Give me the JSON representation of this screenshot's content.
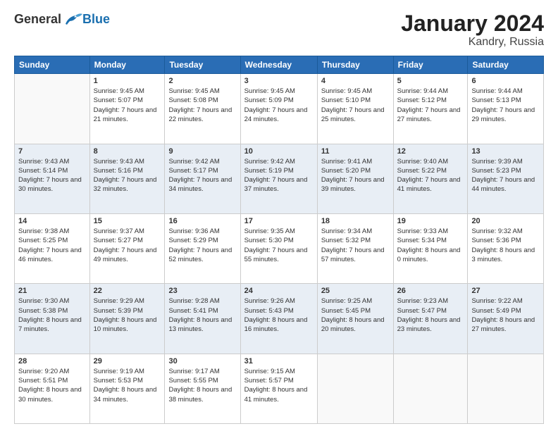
{
  "logo": {
    "general": "General",
    "blue": "Blue"
  },
  "title": "January 2024",
  "location": "Kandry, Russia",
  "days_header": [
    "Sunday",
    "Monday",
    "Tuesday",
    "Wednesday",
    "Thursday",
    "Friday",
    "Saturday"
  ],
  "weeks": [
    [
      {
        "num": "",
        "sunrise": "",
        "sunset": "",
        "daylight": ""
      },
      {
        "num": "1",
        "sunrise": "Sunrise: 9:45 AM",
        "sunset": "Sunset: 5:07 PM",
        "daylight": "Daylight: 7 hours and 21 minutes."
      },
      {
        "num": "2",
        "sunrise": "Sunrise: 9:45 AM",
        "sunset": "Sunset: 5:08 PM",
        "daylight": "Daylight: 7 hours and 22 minutes."
      },
      {
        "num": "3",
        "sunrise": "Sunrise: 9:45 AM",
        "sunset": "Sunset: 5:09 PM",
        "daylight": "Daylight: 7 hours and 24 minutes."
      },
      {
        "num": "4",
        "sunrise": "Sunrise: 9:45 AM",
        "sunset": "Sunset: 5:10 PM",
        "daylight": "Daylight: 7 hours and 25 minutes."
      },
      {
        "num": "5",
        "sunrise": "Sunrise: 9:44 AM",
        "sunset": "Sunset: 5:12 PM",
        "daylight": "Daylight: 7 hours and 27 minutes."
      },
      {
        "num": "6",
        "sunrise": "Sunrise: 9:44 AM",
        "sunset": "Sunset: 5:13 PM",
        "daylight": "Daylight: 7 hours and 29 minutes."
      }
    ],
    [
      {
        "num": "7",
        "sunrise": "Sunrise: 9:43 AM",
        "sunset": "Sunset: 5:14 PM",
        "daylight": "Daylight: 7 hours and 30 minutes."
      },
      {
        "num": "8",
        "sunrise": "Sunrise: 9:43 AM",
        "sunset": "Sunset: 5:16 PM",
        "daylight": "Daylight: 7 hours and 32 minutes."
      },
      {
        "num": "9",
        "sunrise": "Sunrise: 9:42 AM",
        "sunset": "Sunset: 5:17 PM",
        "daylight": "Daylight: 7 hours and 34 minutes."
      },
      {
        "num": "10",
        "sunrise": "Sunrise: 9:42 AM",
        "sunset": "Sunset: 5:19 PM",
        "daylight": "Daylight: 7 hours and 37 minutes."
      },
      {
        "num": "11",
        "sunrise": "Sunrise: 9:41 AM",
        "sunset": "Sunset: 5:20 PM",
        "daylight": "Daylight: 7 hours and 39 minutes."
      },
      {
        "num": "12",
        "sunrise": "Sunrise: 9:40 AM",
        "sunset": "Sunset: 5:22 PM",
        "daylight": "Daylight: 7 hours and 41 minutes."
      },
      {
        "num": "13",
        "sunrise": "Sunrise: 9:39 AM",
        "sunset": "Sunset: 5:23 PM",
        "daylight": "Daylight: 7 hours and 44 minutes."
      }
    ],
    [
      {
        "num": "14",
        "sunrise": "Sunrise: 9:38 AM",
        "sunset": "Sunset: 5:25 PM",
        "daylight": "Daylight: 7 hours and 46 minutes."
      },
      {
        "num": "15",
        "sunrise": "Sunrise: 9:37 AM",
        "sunset": "Sunset: 5:27 PM",
        "daylight": "Daylight: 7 hours and 49 minutes."
      },
      {
        "num": "16",
        "sunrise": "Sunrise: 9:36 AM",
        "sunset": "Sunset: 5:29 PM",
        "daylight": "Daylight: 7 hours and 52 minutes."
      },
      {
        "num": "17",
        "sunrise": "Sunrise: 9:35 AM",
        "sunset": "Sunset: 5:30 PM",
        "daylight": "Daylight: 7 hours and 55 minutes."
      },
      {
        "num": "18",
        "sunrise": "Sunrise: 9:34 AM",
        "sunset": "Sunset: 5:32 PM",
        "daylight": "Daylight: 7 hours and 57 minutes."
      },
      {
        "num": "19",
        "sunrise": "Sunrise: 9:33 AM",
        "sunset": "Sunset: 5:34 PM",
        "daylight": "Daylight: 8 hours and 0 minutes."
      },
      {
        "num": "20",
        "sunrise": "Sunrise: 9:32 AM",
        "sunset": "Sunset: 5:36 PM",
        "daylight": "Daylight: 8 hours and 3 minutes."
      }
    ],
    [
      {
        "num": "21",
        "sunrise": "Sunrise: 9:30 AM",
        "sunset": "Sunset: 5:38 PM",
        "daylight": "Daylight: 8 hours and 7 minutes."
      },
      {
        "num": "22",
        "sunrise": "Sunrise: 9:29 AM",
        "sunset": "Sunset: 5:39 PM",
        "daylight": "Daylight: 8 hours and 10 minutes."
      },
      {
        "num": "23",
        "sunrise": "Sunrise: 9:28 AM",
        "sunset": "Sunset: 5:41 PM",
        "daylight": "Daylight: 8 hours and 13 minutes."
      },
      {
        "num": "24",
        "sunrise": "Sunrise: 9:26 AM",
        "sunset": "Sunset: 5:43 PM",
        "daylight": "Daylight: 8 hours and 16 minutes."
      },
      {
        "num": "25",
        "sunrise": "Sunrise: 9:25 AM",
        "sunset": "Sunset: 5:45 PM",
        "daylight": "Daylight: 8 hours and 20 minutes."
      },
      {
        "num": "26",
        "sunrise": "Sunrise: 9:23 AM",
        "sunset": "Sunset: 5:47 PM",
        "daylight": "Daylight: 8 hours and 23 minutes."
      },
      {
        "num": "27",
        "sunrise": "Sunrise: 9:22 AM",
        "sunset": "Sunset: 5:49 PM",
        "daylight": "Daylight: 8 hours and 27 minutes."
      }
    ],
    [
      {
        "num": "28",
        "sunrise": "Sunrise: 9:20 AM",
        "sunset": "Sunset: 5:51 PM",
        "daylight": "Daylight: 8 hours and 30 minutes."
      },
      {
        "num": "29",
        "sunrise": "Sunrise: 9:19 AM",
        "sunset": "Sunset: 5:53 PM",
        "daylight": "Daylight: 8 hours and 34 minutes."
      },
      {
        "num": "30",
        "sunrise": "Sunrise: 9:17 AM",
        "sunset": "Sunset: 5:55 PM",
        "daylight": "Daylight: 8 hours and 38 minutes."
      },
      {
        "num": "31",
        "sunrise": "Sunrise: 9:15 AM",
        "sunset": "Sunset: 5:57 PM",
        "daylight": "Daylight: 8 hours and 41 minutes."
      },
      {
        "num": "",
        "sunrise": "",
        "sunset": "",
        "daylight": ""
      },
      {
        "num": "",
        "sunrise": "",
        "sunset": "",
        "daylight": ""
      },
      {
        "num": "",
        "sunrise": "",
        "sunset": "",
        "daylight": ""
      }
    ]
  ]
}
